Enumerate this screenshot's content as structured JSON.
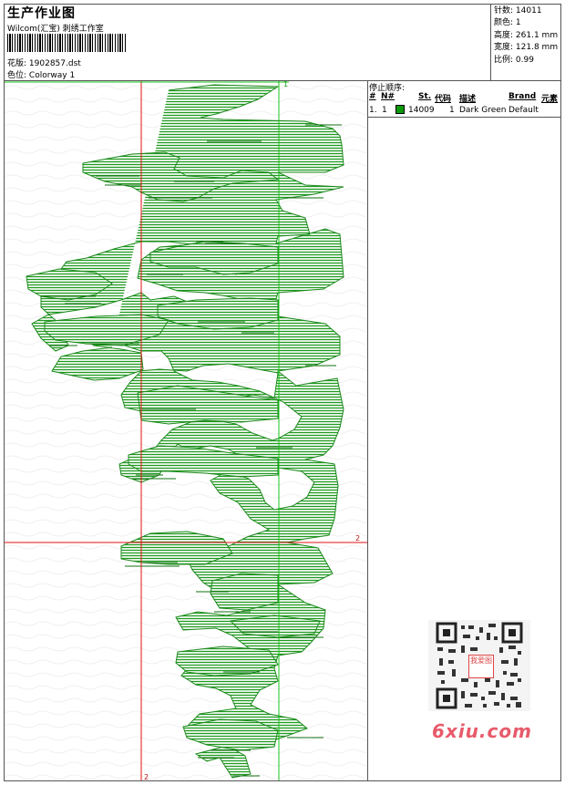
{
  "header": {
    "title": "生产作业图",
    "company": "Wilcom(汇宝) 刺绣工作室",
    "design_label": "花版:",
    "design_value": "1902857.dst",
    "color_label": "色位:",
    "color_value": "Colorway 1"
  },
  "stats": [
    {
      "label": "针数:",
      "value": "14011"
    },
    {
      "label": "颜色:",
      "value": "1"
    },
    {
      "label": "高度:",
      "value": "261.1 mm"
    },
    {
      "label": "宽度:",
      "value": "121.8 mm"
    },
    {
      "label": "比例:",
      "value": "0.99"
    }
  ],
  "stop_sequence": {
    "title": "停止顺序:",
    "columns": [
      "#",
      "N#",
      "St.",
      "代码",
      "描述",
      "Brand",
      "元素"
    ],
    "rows": [
      {
        "index": "1.",
        "n": "1",
        "swatch_color": "#0a9a0a",
        "stitches": "14009",
        "code": "1",
        "description": "Dark Green",
        "brand": "Default",
        "element": ""
      }
    ]
  },
  "markers": {
    "top": "1",
    "right": "2",
    "bottom": "2"
  },
  "colors": {
    "thread": "#1f9a1f",
    "guide_red": "#e01010",
    "guide_green": "#18c418"
  },
  "watermark": {
    "text": "6xiu.com",
    "logo": "我爱图"
  }
}
